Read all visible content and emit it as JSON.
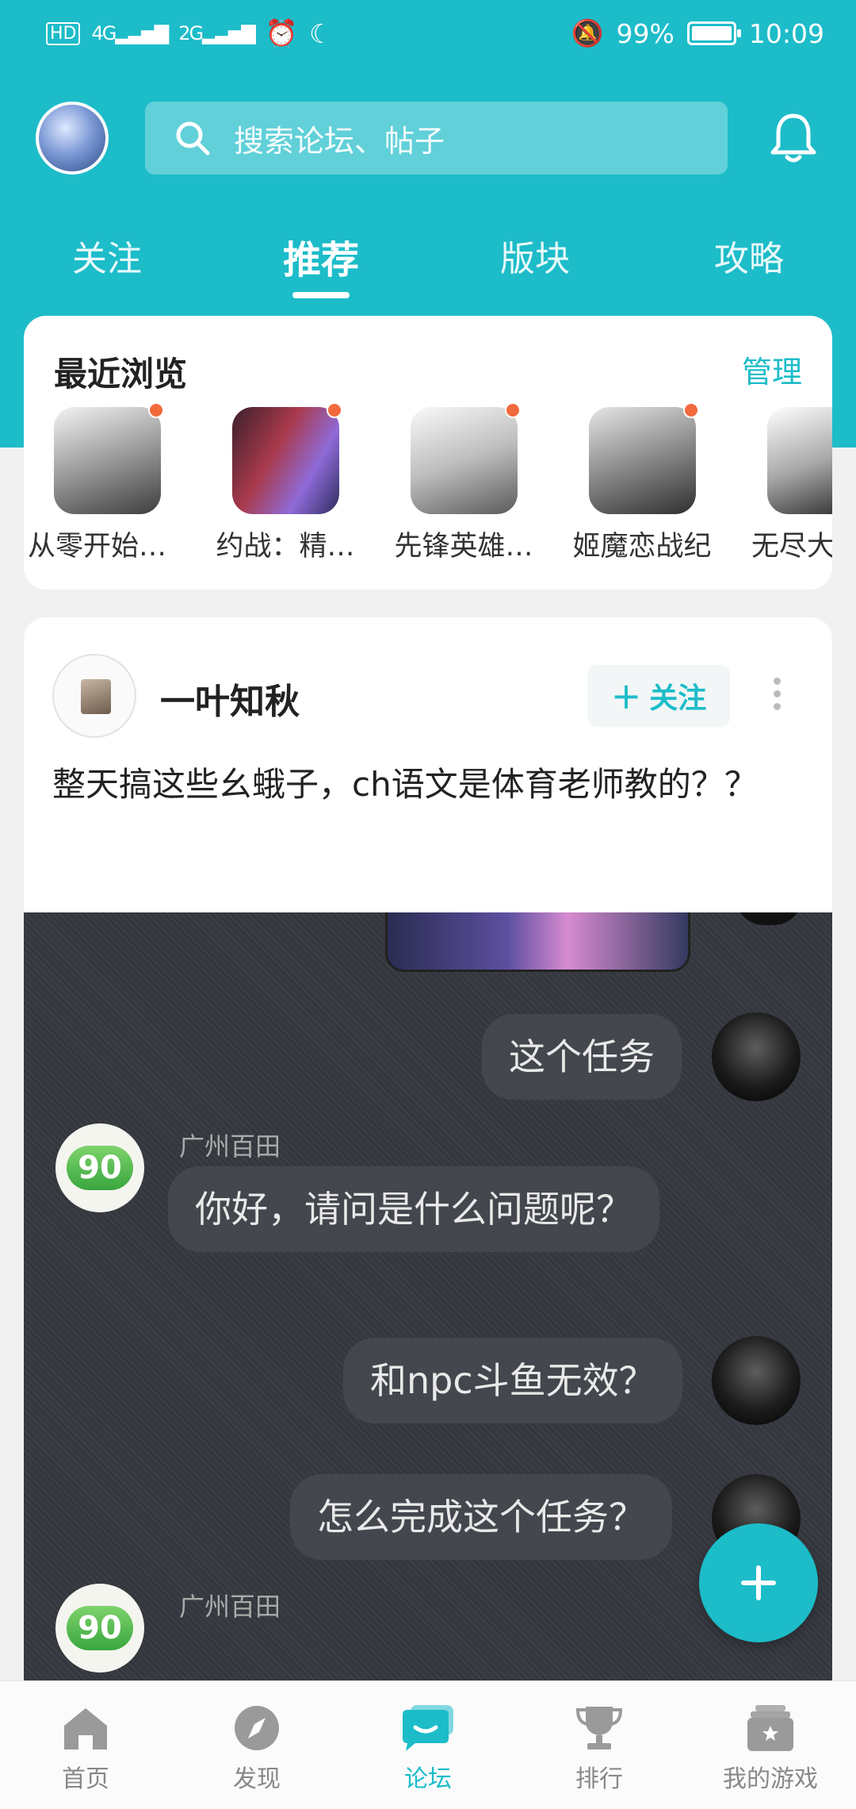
{
  "status_bar": {
    "battery": "99%",
    "time": "10:09",
    "net1": "4G",
    "net2": "2G"
  },
  "header": {
    "search_placeholder": "搜索论坛、帖子"
  },
  "tabs": [
    {
      "label": "关注"
    },
    {
      "label": "推荐"
    },
    {
      "label": "版块"
    },
    {
      "label": "攻略"
    }
  ],
  "recent": {
    "title": "最近浏览",
    "manage": "管理",
    "games": [
      {
        "name": "从零开始…"
      },
      {
        "name": "约战：精…"
      },
      {
        "name": "先锋英雄…"
      },
      {
        "name": "姬魔恋战纪"
      },
      {
        "name": "无尽大冒"
      }
    ]
  },
  "post": {
    "author": "一叶知秋",
    "follow": "关注",
    "text": "整天搞这些幺蛾子，ch语文是体育老师教的？？",
    "chat": {
      "msg1": "这个任务",
      "sender": "广州百田",
      "msg2": "你好，请问是什么问题呢？",
      "msg3": "和npc斗鱼无效？",
      "msg4": "怎么完成这个任务？",
      "sender2": "广州百田",
      "logo_text": "90"
    }
  },
  "nav": [
    {
      "label": "首页"
    },
    {
      "label": "发现"
    },
    {
      "label": "论坛"
    },
    {
      "label": "排行"
    },
    {
      "label": "我的游戏"
    }
  ],
  "colors": {
    "accent": "#1dbcc9",
    "badge": "#f2693c"
  }
}
